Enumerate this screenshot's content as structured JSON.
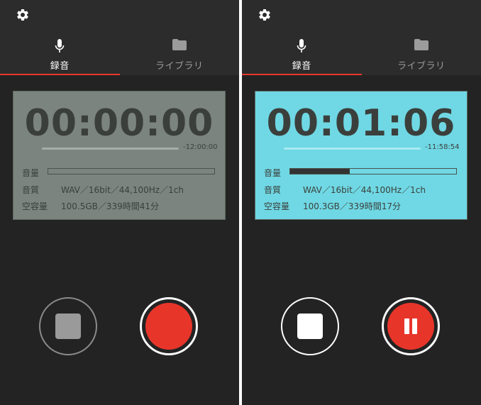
{
  "screens": [
    {
      "tabs": [
        {
          "label": "録音",
          "icon": "microphone-icon",
          "active": true
        },
        {
          "label": "ライブラリ",
          "icon": "folder-icon",
          "active": false
        }
      ],
      "panel": {
        "state": "idle",
        "background": "#7b847e",
        "timer": "00:00:00",
        "remaining": "-12:00:00",
        "level_label": "音量",
        "level_fraction": 0.0,
        "quality_label": "音質",
        "quality_value": "WAV／16bit／44,100Hz／1ch",
        "space_label": "空容量",
        "space_value": "100.5GB／339時間41分"
      },
      "controls": {
        "stop_square_color": "#9a9a9a",
        "record_state": "record"
      }
    },
    {
      "tabs": [
        {
          "label": "録音",
          "icon": "microphone-icon",
          "active": true
        },
        {
          "label": "ライブラリ",
          "icon": "folder-icon",
          "active": false
        }
      ],
      "panel": {
        "state": "recording",
        "background": "#6fd8e4",
        "timer": "00:01:06",
        "remaining": "-11:58:54",
        "level_label": "音量",
        "level_fraction": 0.36,
        "quality_label": "音質",
        "quality_value": "WAV／16bit／44,100Hz／1ch",
        "space_label": "空容量",
        "space_value": "100.3GB／339時間17分"
      },
      "controls": {
        "stop_square_color": "#ffffff",
        "record_state": "pause"
      }
    }
  ],
  "colors": {
    "accent": "#e8392c",
    "background": "#232323",
    "header": "#2c2c2c"
  }
}
